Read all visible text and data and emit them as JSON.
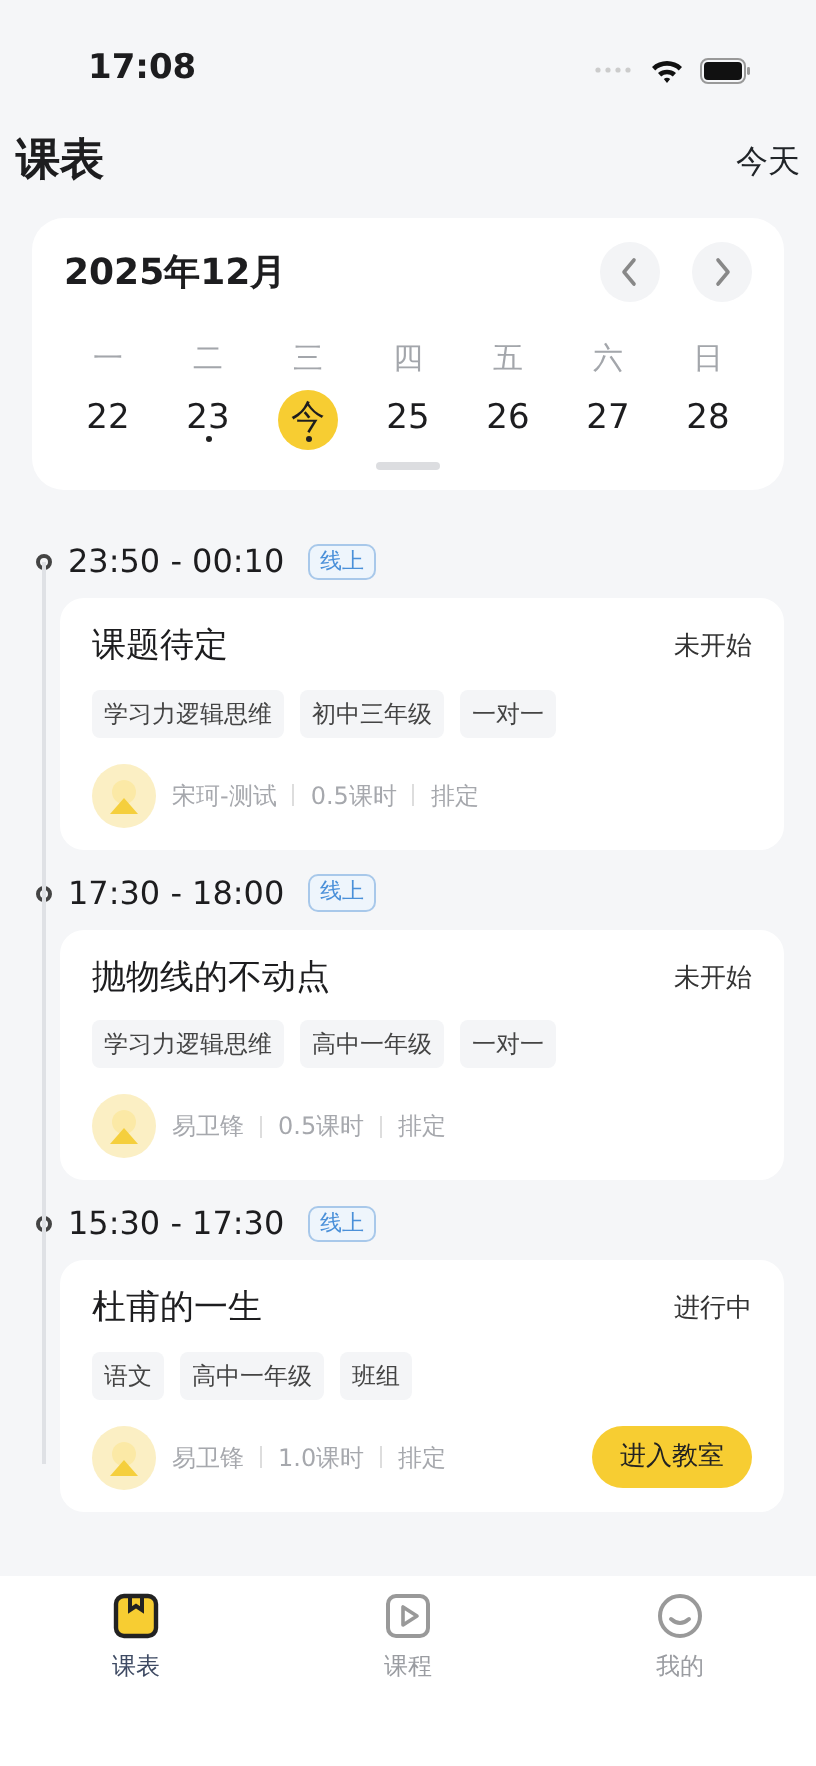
{
  "status_bar": {
    "time": "17:08"
  },
  "header": {
    "title": "课表",
    "today_link": "今天"
  },
  "calendar": {
    "month": "2025年12月",
    "weekdays": [
      "一",
      "二",
      "三",
      "四",
      "五",
      "六",
      "日"
    ],
    "days": [
      {
        "label": "22",
        "selected": false,
        "has_lesson": false
      },
      {
        "label": "23",
        "selected": false,
        "has_lesson": true
      },
      {
        "label": "今",
        "selected": true,
        "has_lesson": true
      },
      {
        "label": "25",
        "selected": false,
        "has_lesson": false
      },
      {
        "label": "26",
        "selected": false,
        "has_lesson": false
      },
      {
        "label": "27",
        "selected": false,
        "has_lesson": false
      },
      {
        "label": "28",
        "selected": false,
        "has_lesson": false
      }
    ]
  },
  "lessons": [
    {
      "time": "23:50 - 00:10",
      "mode": "线上",
      "title": "课题待定",
      "status": "未开始",
      "tags": [
        "学习力逻辑思维",
        "初中三年级",
        "一对一"
      ],
      "teacher": "宋珂-测试",
      "hours": "0.5课时",
      "schedule": "排定"
    },
    {
      "time": "17:30 - 18:00",
      "mode": "线上",
      "title": "抛物线的不动点",
      "status": "未开始",
      "tags": [
        "学习力逻辑思维",
        "高中一年级",
        "一对一"
      ],
      "teacher": "易卫锋",
      "hours": "0.5课时",
      "schedule": "排定"
    },
    {
      "time": "15:30 - 17:30",
      "mode": "线上",
      "title": "杜甫的一生",
      "status": "进行中",
      "tags": [
        "语文",
        "高中一年级",
        "班组"
      ],
      "teacher": "易卫锋",
      "hours": "1.0课时",
      "schedule": "排定",
      "action": "进入教室"
    }
  ],
  "tab_bar": [
    {
      "label": "课表",
      "selected": true
    },
    {
      "label": "课程",
      "selected": false
    },
    {
      "label": "我的",
      "selected": false
    }
  ]
}
